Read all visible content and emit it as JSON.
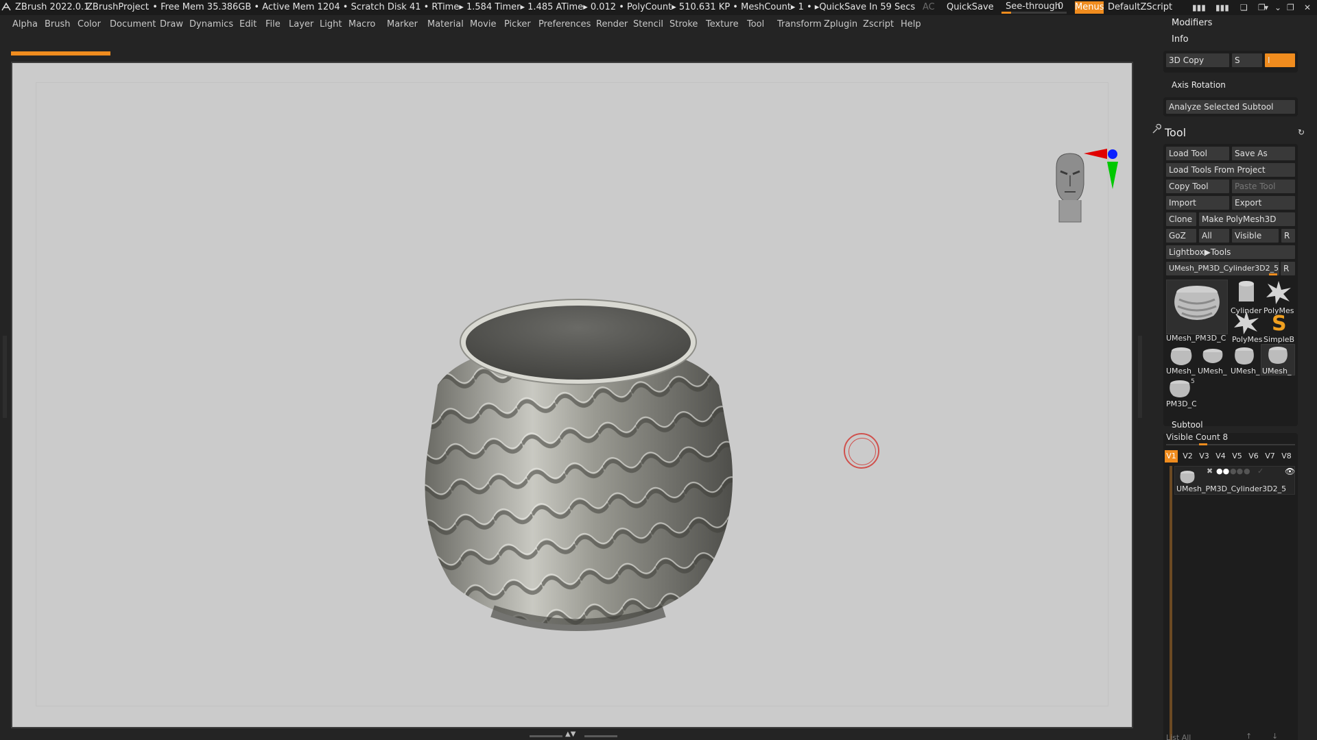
{
  "titlebar": {
    "app": "ZBrush 2022.0.1",
    "project": "ZBrushProject",
    "stats": ". • Free Mem 35.386GB • Active Mem 1204 • Scratch Disk 41 • RTime▸ 1.584 Timer▸ 1.485 ATime▸ 0.012 • PolyCount▸ 510.631 KP • MeshCount▸ 1 • ▸QuickSave In 59 Secs",
    "ac": "AC",
    "quicksave": "QuickSave",
    "seethrough": "See-through",
    "seethrough_value": "0",
    "seethrough_level": 0.0,
    "menus": "Menus",
    "default_zscript": "DefaultZScript"
  },
  "menubar": [
    "Alpha",
    "Brush",
    "Color",
    "Document",
    "Draw",
    "Dynamics",
    "Edit",
    "File",
    "Layer",
    "Light",
    "Macro",
    "Marker",
    "Material",
    "Movie",
    "Picker",
    "Preferences",
    "Render",
    "Stencil",
    "Stroke",
    "Texture",
    "Tool",
    "Transform",
    "Zplugin",
    "Zscript",
    "Help"
  ],
  "panel": {
    "modifiers": "Modifiers",
    "info": "Info",
    "copy3d": "3D Copy",
    "s": "S",
    "i": "I",
    "axis_rotation": "Axis Rotation",
    "analyze": "Analyze Selected Subtool",
    "tool_title": "Tool",
    "load_tool": "Load Tool",
    "save_as": "Save As",
    "load_tools_project": "Load Tools From Project",
    "copy_tool": "Copy Tool",
    "paste_tool": "Paste Tool",
    "import": "Import",
    "export": "Export",
    "clone": "Clone",
    "make_polymesh": "Make PolyMesh3D",
    "goz": "GoZ",
    "all": "All",
    "visible": "Visible",
    "r": "R",
    "lightbox_tools": "Lightbox▶Tools",
    "current_tool": "UMesh_PM3D_Cylinder3D2_5",
    "thumbs_big": "UMesh_PM3D_C",
    "thumb_cylinder": "Cylinder",
    "thumb_polymesh": "PolyMes",
    "thumb_polymesh2": "PolyMes",
    "thumb_simple": "SimpleB",
    "thumb_s": "S",
    "thumb_umesh": "UMesh_",
    "thumb_pm3d": "PM3D_C",
    "thumb_5": "5",
    "subtool": "Subtool",
    "visible_count": "Visible Count 8",
    "vtabs": [
      "V1",
      "V2",
      "V3",
      "V4",
      "V5",
      "V6",
      "V7",
      "V8"
    ],
    "subtool_name": "UMesh_PM3D_Cylinder3D2_5",
    "list_all": "List All"
  }
}
